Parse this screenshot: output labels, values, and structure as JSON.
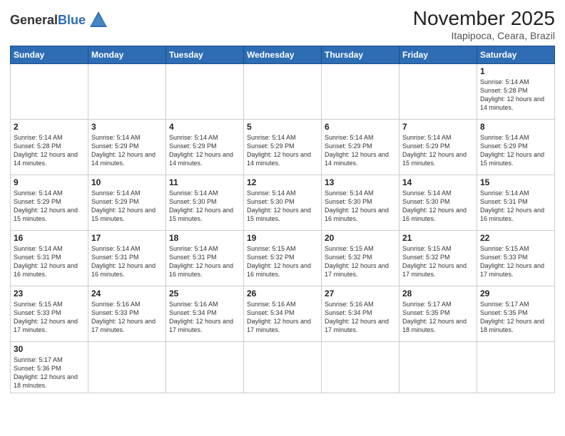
{
  "logo": {
    "text_general": "General",
    "text_blue": "Blue"
  },
  "title": "November 2025",
  "subtitle": "Itapipoca, Ceara, Brazil",
  "days_of_week": [
    "Sunday",
    "Monday",
    "Tuesday",
    "Wednesday",
    "Thursday",
    "Friday",
    "Saturday"
  ],
  "weeks": [
    [
      {
        "day": "",
        "info": ""
      },
      {
        "day": "",
        "info": ""
      },
      {
        "day": "",
        "info": ""
      },
      {
        "day": "",
        "info": ""
      },
      {
        "day": "",
        "info": ""
      },
      {
        "day": "",
        "info": ""
      },
      {
        "day": "1",
        "info": "Sunrise: 5:14 AM\nSunset: 5:28 PM\nDaylight: 12 hours and 14 minutes."
      }
    ],
    [
      {
        "day": "2",
        "info": "Sunrise: 5:14 AM\nSunset: 5:28 PM\nDaylight: 12 hours and 14 minutes."
      },
      {
        "day": "3",
        "info": "Sunrise: 5:14 AM\nSunset: 5:29 PM\nDaylight: 12 hours and 14 minutes."
      },
      {
        "day": "4",
        "info": "Sunrise: 5:14 AM\nSunset: 5:29 PM\nDaylight: 12 hours and 14 minutes."
      },
      {
        "day": "5",
        "info": "Sunrise: 5:14 AM\nSunset: 5:29 PM\nDaylight: 12 hours and 14 minutes."
      },
      {
        "day": "6",
        "info": "Sunrise: 5:14 AM\nSunset: 5:29 PM\nDaylight: 12 hours and 14 minutes."
      },
      {
        "day": "7",
        "info": "Sunrise: 5:14 AM\nSunset: 5:29 PM\nDaylight: 12 hours and 15 minutes."
      },
      {
        "day": "8",
        "info": "Sunrise: 5:14 AM\nSunset: 5:29 PM\nDaylight: 12 hours and 15 minutes."
      }
    ],
    [
      {
        "day": "9",
        "info": "Sunrise: 5:14 AM\nSunset: 5:29 PM\nDaylight: 12 hours and 15 minutes."
      },
      {
        "day": "10",
        "info": "Sunrise: 5:14 AM\nSunset: 5:29 PM\nDaylight: 12 hours and 15 minutes."
      },
      {
        "day": "11",
        "info": "Sunrise: 5:14 AM\nSunset: 5:30 PM\nDaylight: 12 hours and 15 minutes."
      },
      {
        "day": "12",
        "info": "Sunrise: 5:14 AM\nSunset: 5:30 PM\nDaylight: 12 hours and 15 minutes."
      },
      {
        "day": "13",
        "info": "Sunrise: 5:14 AM\nSunset: 5:30 PM\nDaylight: 12 hours and 16 minutes."
      },
      {
        "day": "14",
        "info": "Sunrise: 5:14 AM\nSunset: 5:30 PM\nDaylight: 12 hours and 16 minutes."
      },
      {
        "day": "15",
        "info": "Sunrise: 5:14 AM\nSunset: 5:31 PM\nDaylight: 12 hours and 16 minutes."
      }
    ],
    [
      {
        "day": "16",
        "info": "Sunrise: 5:14 AM\nSunset: 5:31 PM\nDaylight: 12 hours and 16 minutes."
      },
      {
        "day": "17",
        "info": "Sunrise: 5:14 AM\nSunset: 5:31 PM\nDaylight: 12 hours and 16 minutes."
      },
      {
        "day": "18",
        "info": "Sunrise: 5:14 AM\nSunset: 5:31 PM\nDaylight: 12 hours and 16 minutes."
      },
      {
        "day": "19",
        "info": "Sunrise: 5:15 AM\nSunset: 5:32 PM\nDaylight: 12 hours and 16 minutes."
      },
      {
        "day": "20",
        "info": "Sunrise: 5:15 AM\nSunset: 5:32 PM\nDaylight: 12 hours and 17 minutes."
      },
      {
        "day": "21",
        "info": "Sunrise: 5:15 AM\nSunset: 5:32 PM\nDaylight: 12 hours and 17 minutes."
      },
      {
        "day": "22",
        "info": "Sunrise: 5:15 AM\nSunset: 5:33 PM\nDaylight: 12 hours and 17 minutes."
      }
    ],
    [
      {
        "day": "23",
        "info": "Sunrise: 5:15 AM\nSunset: 5:33 PM\nDaylight: 12 hours and 17 minutes."
      },
      {
        "day": "24",
        "info": "Sunrise: 5:16 AM\nSunset: 5:33 PM\nDaylight: 12 hours and 17 minutes."
      },
      {
        "day": "25",
        "info": "Sunrise: 5:16 AM\nSunset: 5:34 PM\nDaylight: 12 hours and 17 minutes."
      },
      {
        "day": "26",
        "info": "Sunrise: 5:16 AM\nSunset: 5:34 PM\nDaylight: 12 hours and 17 minutes."
      },
      {
        "day": "27",
        "info": "Sunrise: 5:16 AM\nSunset: 5:34 PM\nDaylight: 12 hours and 17 minutes."
      },
      {
        "day": "28",
        "info": "Sunrise: 5:17 AM\nSunset: 5:35 PM\nDaylight: 12 hours and 18 minutes."
      },
      {
        "day": "29",
        "info": "Sunrise: 5:17 AM\nSunset: 5:35 PM\nDaylight: 12 hours and 18 minutes."
      }
    ],
    [
      {
        "day": "30",
        "info": "Sunrise: 5:17 AM\nSunset: 5:36 PM\nDaylight: 12 hours and 18 minutes."
      },
      {
        "day": "",
        "info": ""
      },
      {
        "day": "",
        "info": ""
      },
      {
        "day": "",
        "info": ""
      },
      {
        "day": "",
        "info": ""
      },
      {
        "day": "",
        "info": ""
      },
      {
        "day": "",
        "info": ""
      }
    ]
  ]
}
